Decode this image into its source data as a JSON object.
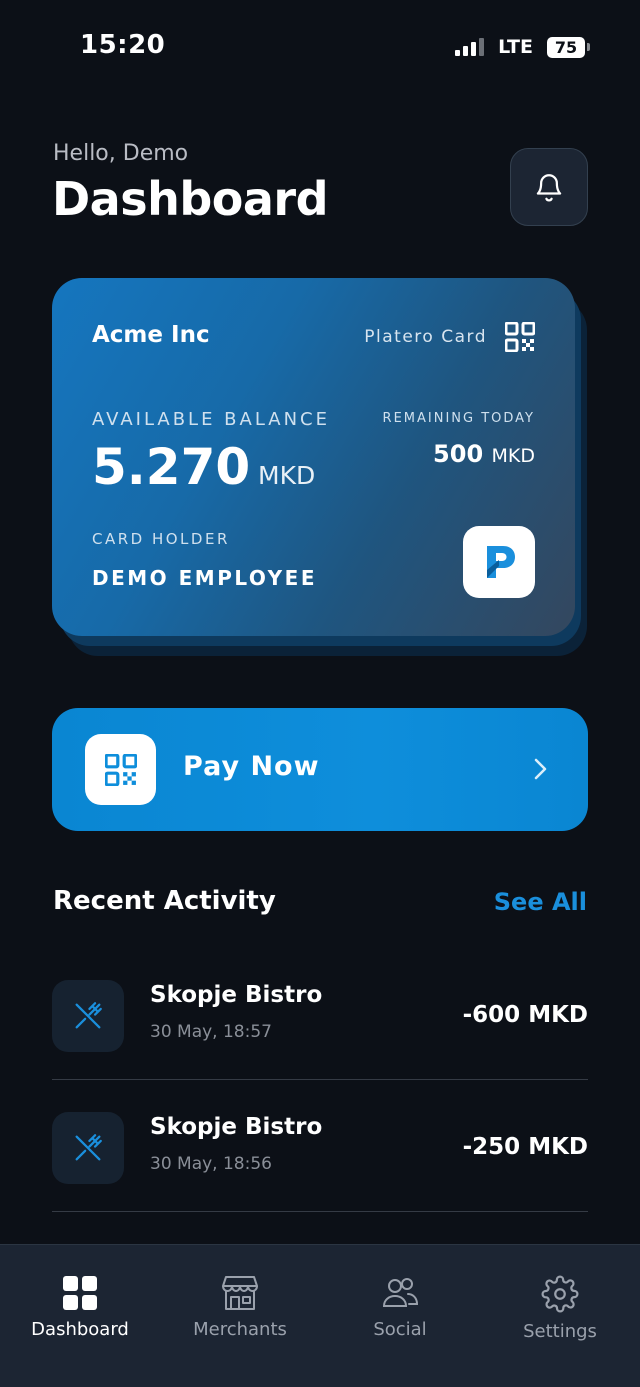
{
  "status_bar": {
    "time": "15:20",
    "network": "LTE",
    "battery": "75"
  },
  "header": {
    "greeting": "Hello, Demo",
    "title": "Dashboard"
  },
  "card": {
    "company": "Acme Inc",
    "brand": "Platero Card",
    "balance_label": "AVAILABLE BALANCE",
    "balance": "5.270",
    "currency": "MKD",
    "remaining_label": "REMAINING TODAY",
    "remaining_value": "500",
    "remaining_currency": "MKD",
    "holder_label": "CARD HOLDER",
    "holder_name": "DEMO EMPLOYEE"
  },
  "pay": {
    "label": "Pay Now"
  },
  "activity": {
    "title": "Recent Activity",
    "see_all": "See All",
    "items": [
      {
        "name": "Skopje Bistro",
        "time": "30 May, 18:57",
        "amount": "-600 MKD",
        "icon": "utensils-icon"
      },
      {
        "name": "Skopje Bistro",
        "time": "30 May, 18:56",
        "amount": "-250 MKD",
        "icon": "utensils-icon"
      }
    ]
  },
  "nav": {
    "items": [
      {
        "label": "Dashboard",
        "icon": "grid-icon",
        "active": true
      },
      {
        "label": "Merchants",
        "icon": "store-icon",
        "active": false
      },
      {
        "label": "Social",
        "icon": "users-icon",
        "active": false
      },
      {
        "label": "Settings",
        "icon": "gear-icon",
        "active": false
      }
    ]
  },
  "colors": {
    "background": "#0c1017",
    "accent": "#0e8edb",
    "link": "#1a8fdc",
    "nav_bg": "#1c2533"
  }
}
